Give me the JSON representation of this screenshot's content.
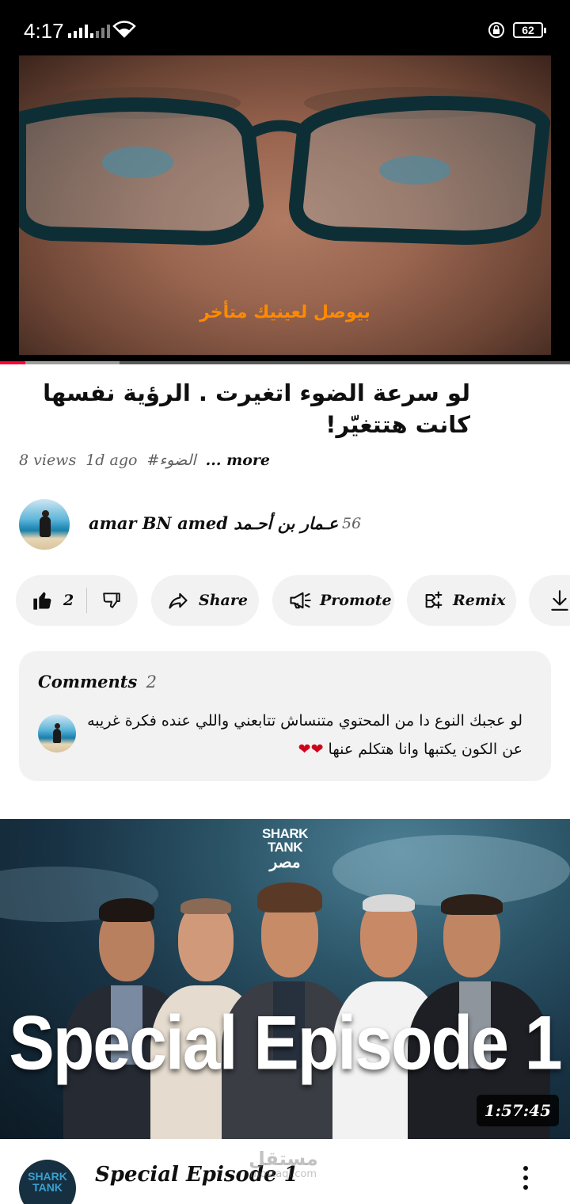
{
  "status_bar": {
    "time": "4:17",
    "battery_level": "62",
    "icons": [
      "signal-icon",
      "signal-icon",
      "wifi-icon",
      "lock-rotation-icon",
      "battery-icon"
    ]
  },
  "player": {
    "subtitle": "بيوصل لعينيك متأخر",
    "progress_played_fraction": 0.045,
    "progress_buffered_fraction": 0.21,
    "accent_color": "#ff0033",
    "subtitle_color": "#ff8a00"
  },
  "video": {
    "title": "لو سرعة الضوء اتغيرت . الرؤية نفسها كانت هتتغيّر!",
    "views": "8 views",
    "age": "1d ago",
    "hashtag": "#الضوء",
    "more": "... more"
  },
  "channel": {
    "name": "amar BN amed عـمار بن أحـمد",
    "subscribers": "56"
  },
  "actions": {
    "like_count": "2",
    "share": "Share",
    "promote": "Promote",
    "remix": "Remix"
  },
  "comments": {
    "label": "Comments",
    "count": "2",
    "top_comment": "لو عجبك النوع دا من المحتوي متنساش تتابعني واللي عنده فكرة غريبه عن الكون يكتبها وانا هتكلم عنها",
    "hearts": "❤❤"
  },
  "next_video": {
    "logo_line1": "SHARK",
    "logo_line2": "TANK",
    "logo_line3": "مصر",
    "thumbnail_title": "Special Episode 1",
    "duration": "1:57:45",
    "title": "Special Episode 1",
    "channel_avatar_text": "SHARK TANK"
  },
  "watermark": {
    "arabic": "مستقل",
    "latin": "mostaql.com"
  }
}
